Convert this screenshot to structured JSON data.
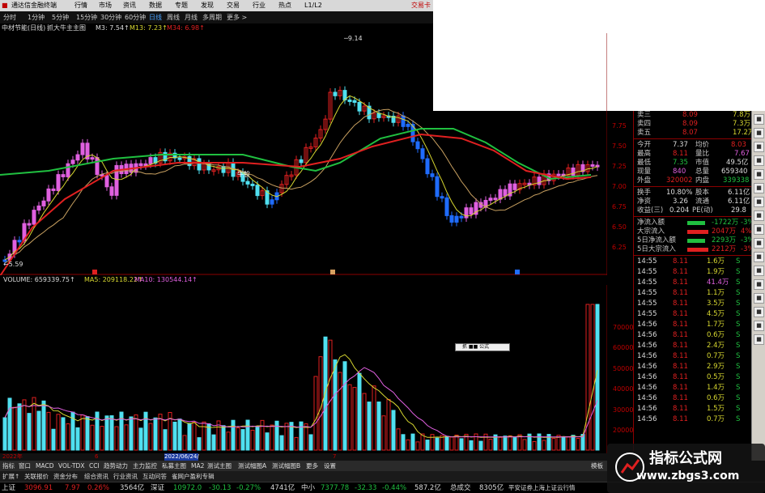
{
  "window": {
    "title": "通达信金融终端",
    "menu": [
      "行情",
      "市场",
      "资讯",
      "数据",
      "专题",
      "发现",
      "交易",
      "行业",
      "热点",
      "L1/L2"
    ],
    "right": "交易卡"
  },
  "periods": [
    "分时",
    "1分钟",
    "5分钟",
    "15分钟",
    "30分钟",
    "60分钟",
    "日线",
    "周线",
    "月线",
    "多周期",
    "更多 >"
  ],
  "period_selected": "日线",
  "info": {
    "stock": "中材节能(日线)",
    "indicator": "抓大牛主主图",
    "m3": "M3: 7.54↑",
    "m13": "M13: 7.23↑",
    "m34": "M34: 6.98↑"
  },
  "chart_labels": {
    "high": "9.14",
    "low": "5.59",
    "annot": "牛股"
  },
  "volume_line": {
    "vol": "VOLUME: 659339.75↑",
    "ma5": "MA5: 209118.22↑",
    "ma10": "MA10: 130544.14↑"
  },
  "price_axis": [
    "7.75",
    "7.50",
    "7.25",
    "7.00",
    "6.75",
    "6.50",
    "6.25"
  ],
  "vol_axis": [
    "70000",
    "60000",
    "50000",
    "40000",
    "30000",
    "20000",
    "10000"
  ],
  "quote": {
    "ask": [
      {
        "label": "卖三",
        "price": "8.09",
        "vol": "7.8万"
      },
      {
        "label": "卖四",
        "price": "8.09",
        "vol": "7.3万"
      },
      {
        "label": "卖五",
        "price": "8.07",
        "vol": "17.2万"
      }
    ],
    "stats": [
      {
        "l1": "今开",
        "v1": "7.37",
        "l2": "均价",
        "v2": "8.03"
      },
      {
        "l1": "最高",
        "v1": "8.11",
        "l2": "量比",
        "v2": "7.67"
      },
      {
        "l1": "最低",
        "v1": "7.35",
        "l2": "市值",
        "v2": "49.5亿"
      },
      {
        "l1": "现量",
        "v1": "840",
        "l2": "总量",
        "v2": "659340"
      },
      {
        "l1": "外盘",
        "v1": "320002",
        "l2": "内盘",
        "v2": "339338"
      },
      {
        "l1": "换手",
        "v1": "10.80%",
        "l2": "股本",
        "v2": "6.11亿"
      },
      {
        "l1": "净资",
        "v1": "3.26",
        "l2": "流通",
        "v2": "6.11亿"
      },
      {
        "l1": "收益(三)",
        "v1": "0.204",
        "l2": "PE(动)",
        "v2": "29.8"
      }
    ],
    "flows": [
      {
        "label": "净流入额",
        "val": "-1722万",
        "pct": "-3%"
      },
      {
        "label": "大宗流入",
        "val": "2047万",
        "pct": "4%"
      },
      {
        "label": "5日净流入额",
        "val": "2293万",
        "pct": "-3%"
      },
      {
        "label": "5日大宗流入",
        "val": "2212万",
        "pct": "-3%"
      }
    ],
    "ticks": [
      {
        "t": "14:55",
        "p": "8.11",
        "v": "1.6万",
        "s": "S"
      },
      {
        "t": "14:55",
        "p": "8.11",
        "v": "1.9万",
        "s": "S"
      },
      {
        "t": "14:55",
        "p": "8.11",
        "v": "41.4万",
        "s": "S"
      },
      {
        "t": "14:55",
        "p": "8.11",
        "v": "1.1万",
        "s": "S"
      },
      {
        "t": "14:55",
        "p": "8.11",
        "v": "3.5万",
        "s": "S"
      },
      {
        "t": "14:55",
        "p": "8.11",
        "v": "4.5万",
        "s": "S"
      },
      {
        "t": "14:56",
        "p": "8.11",
        "v": "1.7万",
        "s": "S"
      },
      {
        "t": "14:56",
        "p": "8.11",
        "v": "0.6万",
        "s": "S"
      },
      {
        "t": "14:56",
        "p": "8.11",
        "v": "2.4万",
        "s": "S"
      },
      {
        "t": "14:56",
        "p": "8.11",
        "v": "0.7万",
        "s": "S"
      },
      {
        "t": "14:56",
        "p": "8.11",
        "v": "2.9万",
        "s": "S"
      },
      {
        "t": "14:56",
        "p": "8.11",
        "v": "0.5万",
        "s": "S"
      },
      {
        "t": "14:56",
        "p": "8.11",
        "v": "1.4万",
        "s": "S"
      },
      {
        "t": "14:56",
        "p": "8.11",
        "v": "0.6万",
        "s": "S"
      },
      {
        "t": "14:56",
        "p": "8.11",
        "v": "1.5万",
        "s": "S"
      },
      {
        "t": "14:56",
        "p": "8.11",
        "v": "0.7万",
        "s": "S"
      }
    ]
  },
  "x_labels": {
    "year": "2022年",
    "date": "2022/06/24/五",
    "m1": "6",
    "m2": "7"
  },
  "popup": "抓 ■■ 公式",
  "tabs": [
    "指标",
    "窗口",
    "MACD",
    "VOL-TDX",
    "CCI",
    "趋势动力",
    "主力监控",
    "私募主图",
    "MA2",
    "测试主图",
    "测试幅图A",
    "测试幅图B",
    "更多",
    "设置"
  ],
  "tabs2": [
    "扩展↑",
    "关联报价",
    "资金分布",
    "综合资讯",
    "行业资讯",
    "互动问答",
    "雀网户盈利专辑"
  ],
  "tabs_right": "模板",
  "status": [
    {
      "label": "上证",
      "val": "3096.91",
      "chg": "7.97",
      "pct": "0.26%",
      "amt": "3564亿"
    },
    {
      "label": "深证",
      "val": "10972.0",
      "chg": "-30.13",
      "pct": "-0.27%",
      "amt": "4741亿"
    },
    {
      "label": "中小",
      "val": "7377.78",
      "chg": "-32.33",
      "pct": "-0.44%",
      "amt": "587.2亿"
    }
  ],
  "status_extra": {
    "label": "总成交",
    "val": "8305亿",
    "notice": "平安证券上海上证云行情"
  },
  "watermark": {
    "title": "指标公式网",
    "url": "www.zbgs3.com"
  },
  "colors": {
    "up": "#e02020",
    "down": "#1f6cff",
    "cyan": "#50e0f0",
    "magenta": "#e060e0",
    "green": "#20c040",
    "yellow": "#d8d830"
  }
}
